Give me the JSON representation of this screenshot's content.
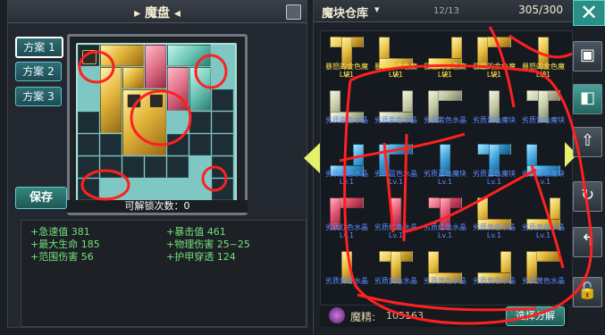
{
  "left_panel": {
    "title": "魔盘",
    "plans": [
      "方案 1",
      "方案 2",
      "方案 3"
    ],
    "save_label": "保存",
    "unlock_label": "可解锁次数：",
    "unlock_count": "0",
    "stats": [
      {
        "label": "+急速值",
        "value": "381"
      },
      {
        "label": "+暴击值",
        "value": "461"
      },
      {
        "label": "+最大生命",
        "value": "185"
      },
      {
        "label": "+物理伤害",
        "value": "25~25"
      },
      {
        "label": "+范围伤害",
        "value": "56"
      },
      {
        "label": "+护甲穿透",
        "value": "124"
      }
    ]
  },
  "right_panel": {
    "title": "魔块仓库",
    "dropdown_icon": "chevron-down-icon",
    "page": "12/13",
    "capacity": "305/300",
    "rows": [
      [
        {
          "name": "暴怒的金色魔块",
          "level": "Lv.1",
          "color": "gold"
        },
        {
          "name": "暴怒的金色魔块",
          "level": "Lv.1",
          "color": "gold"
        },
        {
          "name": "暴怒的金色魔块",
          "level": "Lv.1",
          "color": "gold"
        },
        {
          "name": "暴怒的金色魔块",
          "level": "Lv.1",
          "color": "gold"
        },
        {
          "name": "暴怒的金色魔块",
          "level": "Lv.1",
          "color": "gold"
        }
      ],
      [
        {
          "name": "劣质紫色水晶",
          "level": "",
          "color": "silver"
        },
        {
          "name": "劣质紫色水晶",
          "level": "",
          "color": "silver"
        },
        {
          "name": "劣质紫色水晶",
          "level": "",
          "color": "silver"
        },
        {
          "name": "劣质紫色魔块",
          "level": "",
          "color": "silver"
        },
        {
          "name": "劣质紫色魔块",
          "level": "",
          "color": "silver"
        }
      ],
      [
        {
          "name": "劣质蓝色水晶",
          "level": "Lv.1",
          "color": "blue"
        },
        {
          "name": "劣质蓝色水晶",
          "level": "Lv.1",
          "color": "blue"
        },
        {
          "name": "劣质蓝色魔块",
          "level": "Lv.1",
          "color": "blue"
        },
        {
          "name": "劣质蓝色魔块",
          "level": "Lv.1",
          "color": "blue"
        },
        {
          "name": "劣质蓝色魔块",
          "level": "Lv.1",
          "color": "blue"
        }
      ],
      [
        {
          "name": "劣质红色水晶",
          "level": "Lv.1",
          "color": "red"
        },
        {
          "name": "劣质红色水晶",
          "level": "Lv.1",
          "color": "red"
        },
        {
          "name": "劣质红色水晶",
          "level": "Lv.1",
          "color": "red"
        },
        {
          "name": "劣质黄色水晶",
          "level": "Lv.1",
          "color": "gold"
        },
        {
          "name": "劣质黄色水晶",
          "level": "Lv.1",
          "color": "gold"
        }
      ],
      [
        {
          "name": "劣质黄色水晶",
          "level": "",
          "color": "gold"
        },
        {
          "name": "劣质黄色水晶",
          "level": "",
          "color": "gold"
        },
        {
          "name": "劣质黄色水晶",
          "level": "",
          "color": "gold"
        },
        {
          "name": "劣质黄色水晶",
          "level": "",
          "color": "gold"
        },
        {
          "name": "劣质黄色水晶",
          "level": "",
          "color": "gold"
        }
      ]
    ],
    "essence_label": "魔精:",
    "essence_value": "105163",
    "decompose_label": "选择分解"
  },
  "sidebar": {
    "close_glyph": "✕",
    "buttons": [
      "copy-icon",
      "layout-icon",
      "upload-icon",
      "refresh-icon",
      "back-icon",
      "lock-icon"
    ]
  },
  "colors": {
    "gold": "#f0c94a",
    "blue": "#4fb6e8",
    "red": "#e05470",
    "silver": "#c4c9a6",
    "accent": "#5fd5c8",
    "scribble": "#ff2020"
  }
}
